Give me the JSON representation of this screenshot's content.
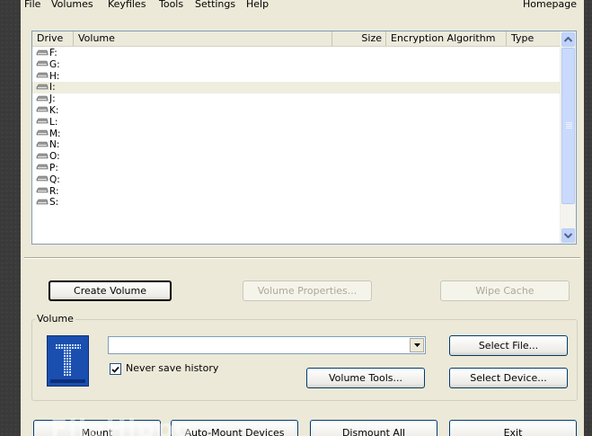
{
  "menu": {
    "file": "File",
    "volumes": "Volumes",
    "keyfiles": "Keyfiles",
    "tools": "Tools",
    "settings": "Settings",
    "help": "Help",
    "homepage": "Homepage"
  },
  "drive_list": {
    "columns": {
      "drive": "Drive",
      "volume": "Volume",
      "size": "Size",
      "encryption_algorithm": "Encryption Algorithm",
      "type": "Type"
    },
    "drives": [
      "F:",
      "G:",
      "H:",
      "I:",
      "J:",
      "K:",
      "L:",
      "M:",
      "N:",
      "O:",
      "P:",
      "Q:",
      "R:",
      "S:"
    ],
    "selected_drive": "I:"
  },
  "buttons": {
    "create_volume": "Create Volume",
    "volume_properties": "Volume Properties...",
    "wipe_cache": "Wipe Cache",
    "select_file": "Select File...",
    "volume_tools": "Volume Tools...",
    "select_device": "Select Device...",
    "mount": "Mount",
    "auto_mount": "Auto-Mount Devices",
    "dismount_all": "Dismount All",
    "exit": "Exit"
  },
  "volume_group": {
    "label": "Volume",
    "path_value": "",
    "never_save_history_label": "Never save history",
    "never_save_history_checked": true
  },
  "watermark": "FileHippo",
  "colors": {
    "window_bg": "#ece9d8",
    "selection": "#efedde",
    "logo_bg": "#1a4fb0"
  }
}
